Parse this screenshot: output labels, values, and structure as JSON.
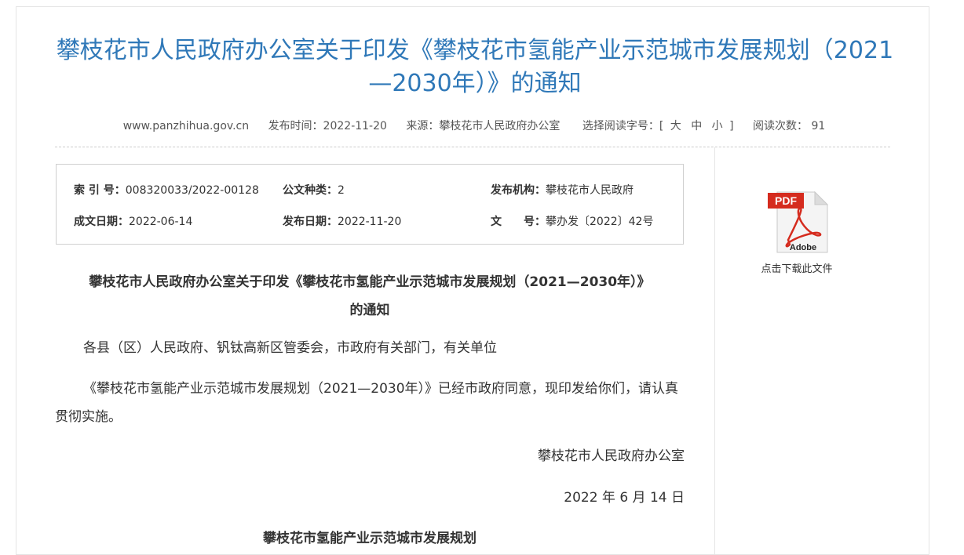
{
  "page": {
    "title": "攀枝花市人民政府办公室关于印发《攀枝花市氢能产业示范城市发展规划（2021—2030年）》的通知"
  },
  "meta": {
    "site": "www.panzhihua.gov.cn",
    "publish_time": "发布时间：2022-11-20",
    "source": "来源：攀枝花市人民政府办公室",
    "font_size_label": "选择阅读字号：[",
    "size_large": "大",
    "size_medium": "中",
    "size_small": "小",
    "font_size_end": "]",
    "views": "阅读次数： 91"
  },
  "info": {
    "index_label": "索 引 号：",
    "index_value": "008320033/2022-00128",
    "category_label": "公文种类：",
    "category_value": "2",
    "org_label": "发布机构：",
    "org_value": "攀枝花市人民政府",
    "written_label": "成文日期：",
    "written_value": "2022-06-14",
    "publish_label": "发布日期：",
    "publish_value": "2022-11-20",
    "docno_label": "文　　号：",
    "docno_value": "攀办发〔2022〕42号"
  },
  "download": {
    "caption": "点击下载此文件",
    "pdf_text": "PDF",
    "adobe_text": "Adobe"
  },
  "doc": {
    "heading_line1": "攀枝花市人民政府办公室关于印发《攀枝花市氢能产业示范城市发展规划（2021—2030年）》",
    "heading_line2": "的通知",
    "recipients": "各县（区）人民政府、钒钛高新区管委会，市政府有关部门，有关单位",
    "body": "《攀枝花市氢能产业示范城市发展规划（2021—2030年）》已经市政府同意，现印发给你们，请认真贯彻实施。",
    "signer": "攀枝花市人民政府办公室",
    "date": "2022 年 6 月 14 日",
    "sub_title": "攀枝花市氢能产业示范城市发展规划"
  }
}
